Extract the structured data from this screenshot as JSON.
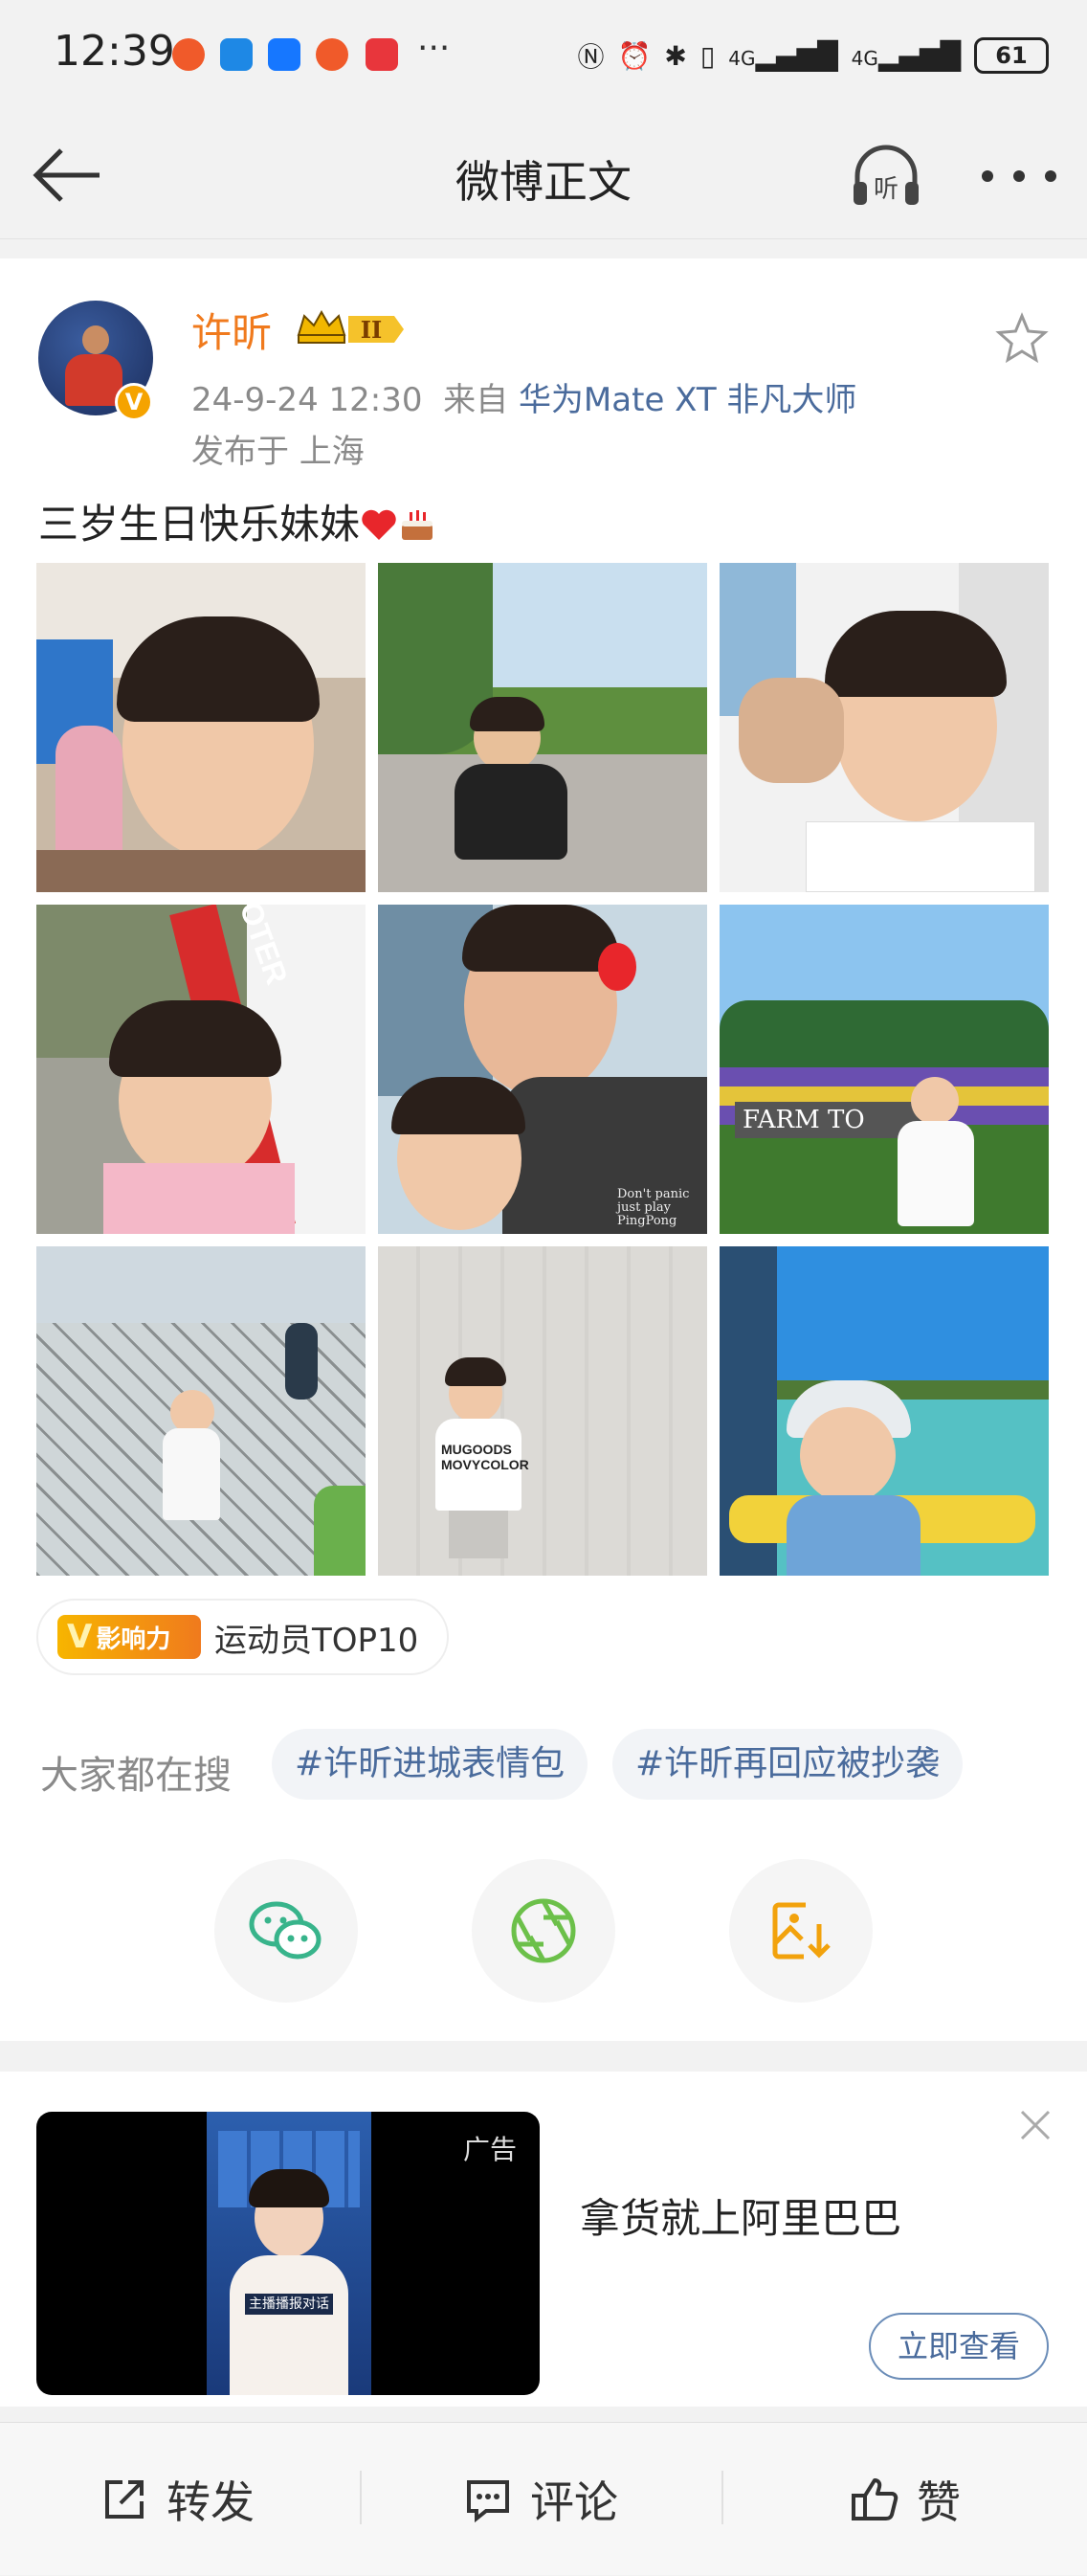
{
  "status_bar": {
    "time": "12:39",
    "more": "···",
    "network": "4G",
    "battery": "61"
  },
  "nav": {
    "title": "微博正文",
    "listen_label": "听"
  },
  "post": {
    "author": "许昕",
    "vip_level": "II",
    "verified_badge": "V",
    "date": "24-9-24 12:30",
    "source_prefix": "来自",
    "source": "华为Mate XT 非凡大师",
    "location": "发布于 上海",
    "text": "三岁生日快乐妹妹",
    "photo_captions": {
      "shirt_text": "Don't panic just play PingPong",
      "farm_sign": "FARM TO",
      "tee_text": "MUGOODS MOVYCOLOR",
      "archery_text": "OOTER"
    },
    "influence": {
      "badge": "影响力",
      "text": "运动员TOP10"
    },
    "search": {
      "label": "大家都在搜",
      "chips": [
        "#许昕进城表情包",
        "#许昕再回应被抄袭"
      ]
    }
  },
  "ad": {
    "tag": "广告",
    "title": "拿货就上阿里巴巴",
    "cta": "立即查看",
    "video_caption": "主播播报对话"
  },
  "bottom_bar": {
    "repost": "转发",
    "comment": "评论",
    "like": "赞"
  },
  "colors": {
    "author": "#f07a1d",
    "link": "#4a6b9c",
    "wechat": "#38b48b",
    "moments": "#6cc04a",
    "save": "#f2a20c"
  }
}
